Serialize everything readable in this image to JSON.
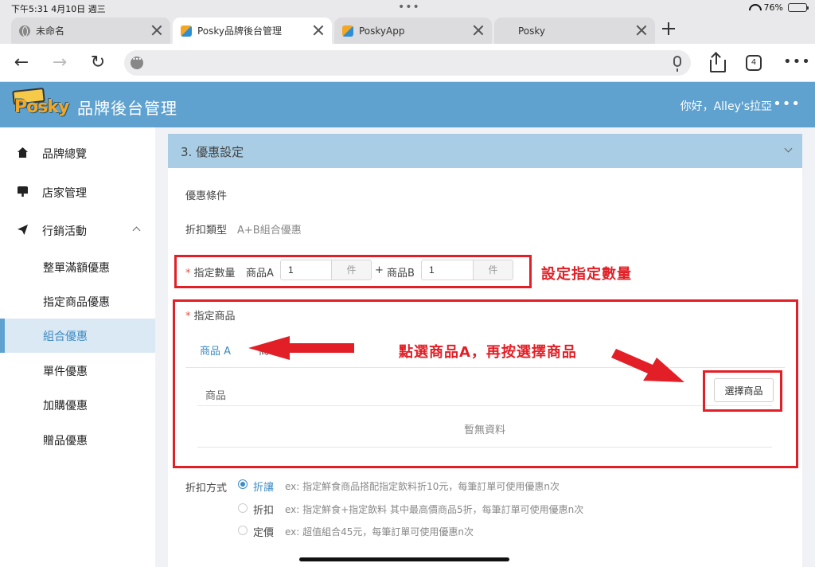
{
  "status_bar": {
    "time": "下午5:31   4月10日 週三",
    "battery": "76%"
  },
  "browser": {
    "tabs": [
      {
        "label": "未命名",
        "icon": "globe-icon",
        "active": false
      },
      {
        "label": "Posky品牌後台管理",
        "icon": "posky-favicon",
        "active": true
      },
      {
        "label": "PoskyApp",
        "icon": "posky-favicon",
        "active": false
      },
      {
        "label": "Posky",
        "icon": "",
        "active": false
      }
    ],
    "tab_count": "4",
    "url": ""
  },
  "header": {
    "title": "品牌後台管理",
    "greeting": "你好，Alley's拉亞",
    "logo_text": "Posky"
  },
  "sidebar": {
    "items": [
      {
        "label": "品牌總覽",
        "icon": "home-icon"
      },
      {
        "label": "店家管理",
        "icon": "store-icon"
      },
      {
        "label": "行銷活動",
        "icon": "paper-plane-icon"
      }
    ],
    "sub_items": [
      "整單滿額優惠",
      "指定商品優惠",
      "組合優惠",
      "單件優惠",
      "加購優惠",
      "贈品優惠"
    ],
    "active_sub": "組合優惠"
  },
  "section": {
    "title": "3. 優惠設定",
    "conditions_label": "優惠條件",
    "discount_type_label": "折扣類型",
    "discount_type_value": "A+B組合優惠",
    "qty": {
      "label": "指定數量",
      "a_label": "商品A",
      "a_value": "1",
      "unit": "件",
      "plus": "+",
      "b_label": "商品B",
      "b_value": "1"
    },
    "products": {
      "label": "指定商品",
      "tab_a": "商品 A",
      "tab_b_partial": "商",
      "column": "商品",
      "choose_button": "選擇商品",
      "empty": "暫無資料"
    },
    "method": {
      "label": "折扣方式",
      "options": [
        {
          "label": "折讓",
          "desc": "ex: 指定鮮食商品搭配指定飲料折10元，每筆訂單可使用優惠n次",
          "checked": true
        },
        {
          "label": "折扣",
          "desc": "ex: 指定鮮食+指定飲料 其中最高價商品5折，每筆訂單可使用優惠n次",
          "checked": false
        },
        {
          "label": "定價",
          "desc": "ex: 超值組合45元，每筆訂單可使用優惠n次",
          "checked": false
        }
      ]
    }
  },
  "annotations": {
    "qty_note": "設定指定數量",
    "product_note": "點選商品A，再按選擇商品",
    "color": "#e21f26"
  },
  "colors": {
    "header": "#5fa2cf",
    "section_head": "#a8cde4",
    "accent": "#3d8ac4"
  }
}
